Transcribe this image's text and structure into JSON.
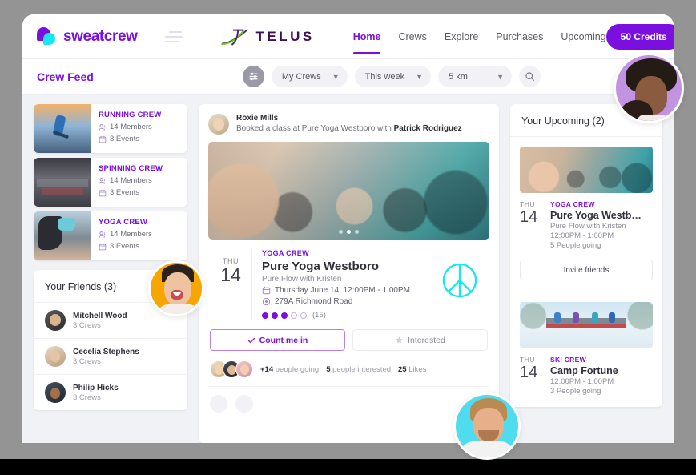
{
  "brand": {
    "name": "sweatcrew",
    "logo_icon": "sweatcrew-drop-logo"
  },
  "partner": {
    "name": "TELUS",
    "logo_icon": "telus-logo"
  },
  "nav": {
    "menu_icon": "hamburger-icon",
    "links": [
      {
        "label": "Home",
        "active": true
      },
      {
        "label": "Crews",
        "active": false
      },
      {
        "label": "Explore",
        "active": false
      },
      {
        "label": "Purchases",
        "active": false
      },
      {
        "label": "Upcoming",
        "active": false
      }
    ],
    "credits_label": "50 Credits",
    "bell_icon": "notification-bell-icon",
    "avatar_icon": "user-avatar"
  },
  "subbar": {
    "title": "Crew Feed",
    "filter_icon": "filter-sliders-icon",
    "search_icon": "search-icon",
    "filters": [
      {
        "label": "My Crews",
        "chevron": "chevron-down-icon"
      },
      {
        "label": "This week",
        "chevron": "chevron-down-icon"
      },
      {
        "label": "5 km",
        "chevron": "chevron-down-icon"
      }
    ]
  },
  "sidebar": {
    "crews": [
      {
        "name": "RUNNING CREW",
        "members": "14 Members",
        "events": "3 Events",
        "thumb": "runner-sunset-photo"
      },
      {
        "name": "SPINNING CREW",
        "members": "14 Members",
        "events": "3 Events",
        "thumb": "spin-class-photo"
      },
      {
        "name": "YOGA CREW",
        "members": "14 Members",
        "events": "3 Events",
        "thumb": "yoga-pose-photo"
      }
    ],
    "members_icon": "people-icon",
    "events_icon": "calendar-icon",
    "friends_title": "Your Friends (3)",
    "friends": [
      {
        "name": "Mitchell Wood",
        "crews": "3 Crews"
      },
      {
        "name": "Cecelia Stephens",
        "crews": "3 Crews"
      },
      {
        "name": "Philip Hicks",
        "crews": "3 Crews"
      }
    ]
  },
  "post": {
    "author": "Roxie Mills",
    "action_prefix": "Booked a class at Pure Yoga Westboro with ",
    "action_person": "Patrick Rodriguez",
    "image": "yoga-class-arms-raised-photo",
    "carousel_dots": 3,
    "carousel_active": 1,
    "event": {
      "dow": "THU",
      "day": "14",
      "crew": "YOGA CREW",
      "title": "Pure Yoga Westboro",
      "subtitle": "Pure Flow with Kristen",
      "datetime": "Thursday June 14, 12:00PM - 1:00PM",
      "date_icon": "calendar-icon",
      "address": "279A Richmond Road",
      "address_icon": "location-pin-icon",
      "rating_filled": 3,
      "rating_total": 5,
      "rating_count": "(15)",
      "badge_icon": "peace-sign-icon",
      "badge_color": "#18E6F0"
    },
    "buttons": {
      "primary_label": "Count me in",
      "primary_icon": "check-icon",
      "secondary_label": "Interested",
      "secondary_icon": "star-icon"
    },
    "stats": {
      "going": "+14",
      "going_label": " people going",
      "interested": "5",
      "interested_label": " people interested",
      "likes": "25",
      "likes_label": " Likes"
    }
  },
  "upcoming": {
    "title": "Your Upcoming (2)",
    "invite_label": "Invite friends",
    "items": [
      {
        "image": "yoga-class-photo",
        "dow": "THU",
        "day": "14",
        "crew": "YOGA CREW",
        "name": "Pure Yoga Westb…",
        "line1": "Pure Flow with Kristen",
        "line2": "12:00PM - 1:00PM",
        "line3": "5 People going",
        "has_invite": true
      },
      {
        "image": "ski-lift-snow-photo",
        "dow": "THU",
        "day": "14",
        "crew": "SKI CREW",
        "name": "Camp Fortune",
        "line1": "",
        "line2": "12:00PM - 1:00PM",
        "line3": "3 People going",
        "has_invite": false
      }
    ]
  },
  "floating_avatars": [
    {
      "name": "avatar-purple",
      "bg": "#c193e0"
    },
    {
      "name": "avatar-orange",
      "bg": "#F7A600"
    },
    {
      "name": "avatar-cyan",
      "bg": "#4FDCEF"
    }
  ],
  "colors": {
    "accent": "#7B0FE0",
    "cyan": "#18E6F0",
    "telus_purple": "#3C1053",
    "page_bg": "#f0f2f6"
  }
}
